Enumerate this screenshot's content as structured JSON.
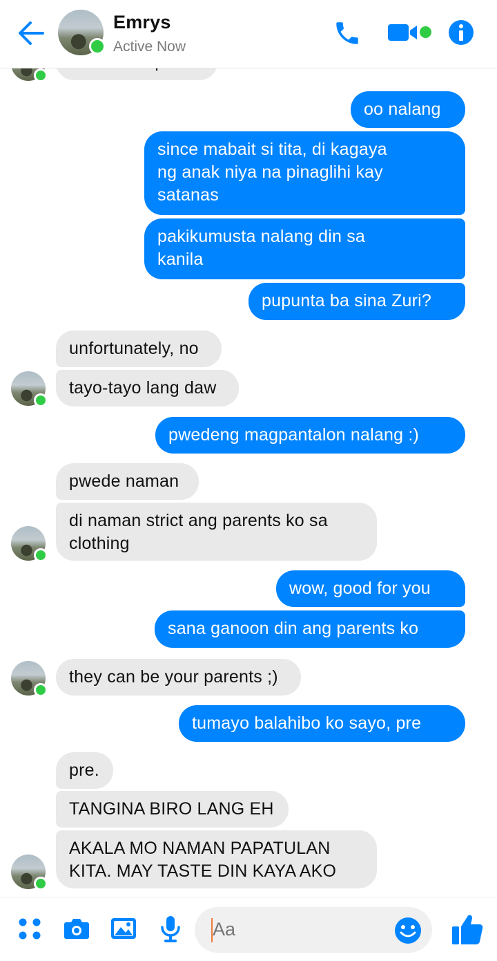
{
  "header": {
    "contact_name": "Emrys",
    "status": "Active Now",
    "icons": [
      "back-arrow-icon",
      "avatar",
      "phone-icon",
      "video-camera-icon",
      "info-icon"
    ],
    "accent_color": "#0084ff",
    "online_color": "#31cc46"
  },
  "messages": [
    {
      "side": "in",
      "text": "same time parin"
    },
    {
      "side": "out",
      "text": "oo nalang"
    },
    {
      "side": "out",
      "text": "since mabait si tita, di kagaya\nng anak niya na pinaglihi kay\nsatanas"
    },
    {
      "side": "out",
      "text": "pakikumusta nalang din sa\nkanila"
    },
    {
      "side": "out",
      "text": "pupunta ba sina Zuri?"
    },
    {
      "side": "in",
      "text": "unfortunately, no"
    },
    {
      "side": "in",
      "text": "tayo-tayo lang daw"
    },
    {
      "side": "out",
      "text": "pwedeng magpantalon nalang :)"
    },
    {
      "side": "in",
      "text": "pwede naman"
    },
    {
      "side": "in",
      "text": "di naman strict ang parents ko sa\nclothing"
    },
    {
      "side": "out",
      "text": "wow, good for you"
    },
    {
      "side": "out",
      "text": "sana ganoon din ang parents ko"
    },
    {
      "side": "in",
      "text": "they can be your parents ;)"
    },
    {
      "side": "out",
      "text": "tumayo balahibo ko sayo, pre"
    },
    {
      "side": "in",
      "text": "pre."
    },
    {
      "side": "in",
      "text": "TANGINA BIRO LANG EH"
    },
    {
      "side": "in",
      "text": "AKALA MO NAMAN PAPATULAN\nKITA. MAY TASTE DIN KAYA AKO"
    }
  ],
  "composer": {
    "placeholder": "Aa",
    "icons": [
      "more-apps-icon",
      "camera-icon",
      "gallery-icon",
      "microphone-icon",
      "emoji-icon",
      "thumbs-up-icon"
    ]
  }
}
